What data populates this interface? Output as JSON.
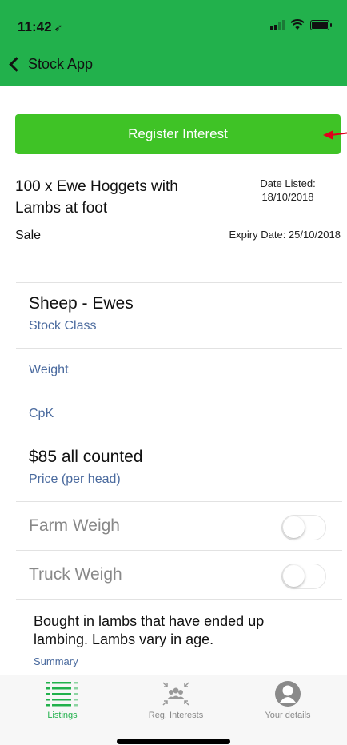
{
  "status": {
    "time": "11:42"
  },
  "nav": {
    "back_label": "Stock App"
  },
  "register_button": {
    "label": "Register Interest"
  },
  "listing": {
    "title": "100 x Ewe Hoggets with Lambs at foot",
    "date_listed_label": "Date Listed:",
    "date_listed_value": "18/10/2018",
    "type": "Sale",
    "expiry": "Expiry Date: 25/10/2018"
  },
  "details": {
    "stock_class_value": "Sheep - Ewes",
    "stock_class_label": "Stock Class",
    "weight_label": "Weight",
    "cpk_label": "CpK",
    "price_value": "$85 all counted",
    "price_label": "Price (per head)",
    "farm_weigh_label": "Farm Weigh",
    "truck_weigh_label": "Truck Weigh"
  },
  "summary": {
    "text": "Bought in lambs that have ended up lambing. Lambs vary in age.",
    "label": "Summary"
  },
  "tabs": [
    {
      "label": "Listings",
      "icon": "list-icon",
      "active": true
    },
    {
      "label": "Reg. Interests",
      "icon": "people-icon",
      "active": false
    },
    {
      "label": "Your details",
      "icon": "user-icon",
      "active": false
    }
  ],
  "colors": {
    "header": "#22b14c",
    "button": "#3fc326",
    "label_blue": "#4a6a9e"
  }
}
